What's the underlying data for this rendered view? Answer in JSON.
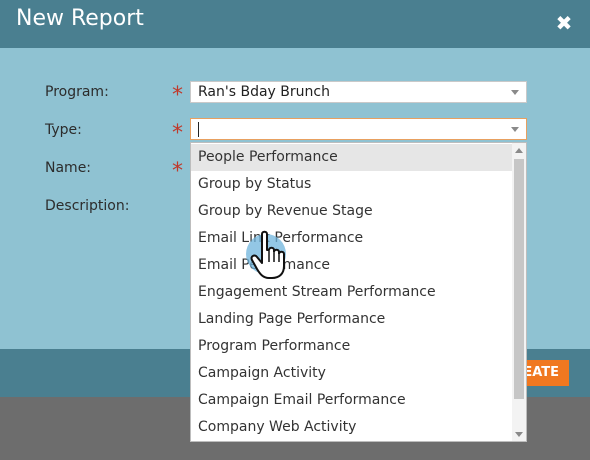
{
  "dialog": {
    "title": "New Report",
    "close_glyph": "✖"
  },
  "form": {
    "program": {
      "label": "Program:",
      "value": "Ran's Bday Brunch",
      "required_mark": "*"
    },
    "type": {
      "label": "Type:",
      "value": "",
      "required_mark": "*"
    },
    "name": {
      "label": "Name:",
      "required_mark": "*"
    },
    "description": {
      "label": "Description:"
    }
  },
  "dropdown": {
    "options": [
      "People Performance",
      "Group by Status",
      "Group by Revenue Stage",
      "Email Link Performance",
      "Email Performance",
      "Engagement Stream Performance",
      "Landing Page Performance",
      "Program Performance",
      "Campaign Activity",
      "Campaign Email Performance",
      "Company Web Activity"
    ],
    "highlighted_index": 0
  },
  "footer": {
    "create_label": "EATE"
  },
  "colors": {
    "header": "#4a7f90",
    "body": "#8fc2d2",
    "accent": "#f07820",
    "required": "#c0392b"
  },
  "icons": [
    "close-icon",
    "dropdown-caret-icon",
    "hand-pointer-cursor-icon"
  ]
}
